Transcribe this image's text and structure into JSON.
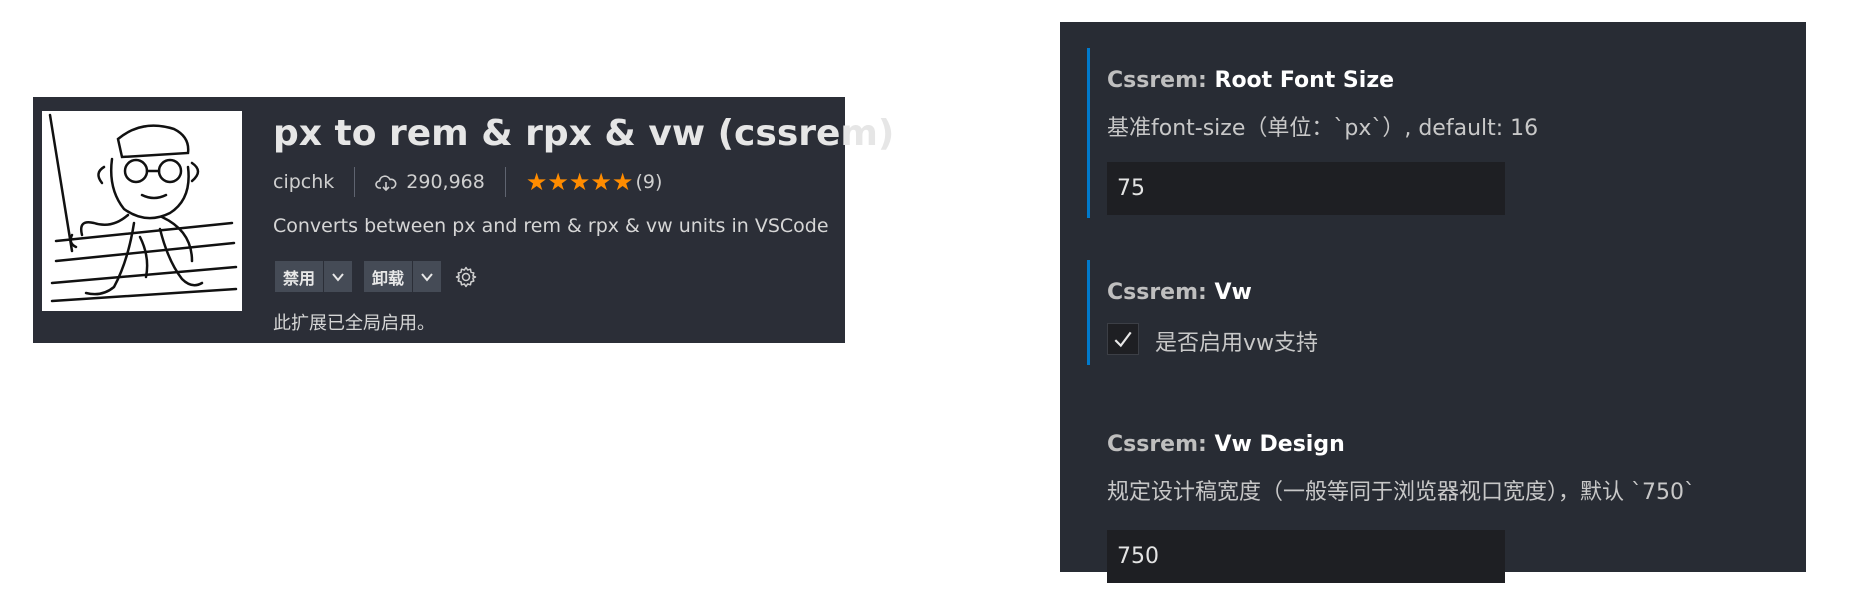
{
  "extension": {
    "title": "px to rem & rpx & vw (cssrem)",
    "publisher": "cipchk",
    "installs": "290,968",
    "stars": "★★★★★",
    "rating_count": "(9)",
    "description": "Converts between px and rem & rpx & vw units in VSCode",
    "disable_label": "禁用",
    "uninstall_label": "卸载",
    "status": "此扩展已全局启用。",
    "icons": {
      "image": "cartoon-logo-icon",
      "installs": "cloud-download-icon",
      "settings": "gear-icon",
      "dropdown": "chevron-down-icon"
    }
  },
  "settings": {
    "root_font_size": {
      "prefix": "Cssrem: ",
      "name": "Root Font Size",
      "description": "基准font-size（单位：`px`）, default: 16",
      "value": "75"
    },
    "vw": {
      "prefix": "Cssrem: ",
      "name": "Vw",
      "checkbox_label": "是否启用vw支持",
      "checked": true
    },
    "vw_design": {
      "prefix": "Cssrem: ",
      "name": "Vw Design",
      "description": "规定设计稿宽度（一般等同于浏览器视口宽度），默认 `750`",
      "value": "750"
    }
  },
  "colors": {
    "card_bg": "#2b2e37",
    "panel_bg": "#282c34",
    "accent_bar": "#007acc",
    "star": "#ff8c00",
    "input_bg": "#1e1f23"
  }
}
